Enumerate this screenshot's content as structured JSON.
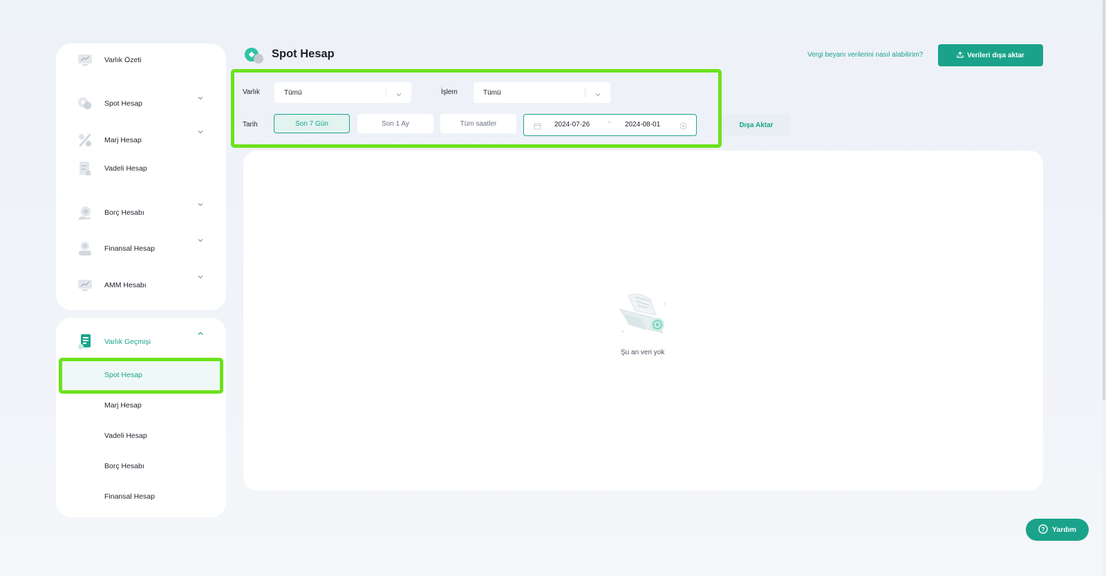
{
  "sidebar": {
    "accounts": [
      {
        "label": "Varlık Özeti",
        "icon": "chart-monitor-icon",
        "has_chevron": false
      },
      {
        "label": "Spot Hesap",
        "icon": "coins-icon",
        "has_chevron": true
      },
      {
        "label": "Marj Hesap",
        "icon": "percent-icon",
        "has_chevron": true
      },
      {
        "label": "Vadeli Hesap",
        "icon": "document-icon",
        "has_chevron": false
      },
      {
        "label": "Borç Hesabı",
        "icon": "loan-coin-icon",
        "has_chevron": true
      },
      {
        "label": "Finansal Hesap",
        "icon": "finance-person-icon",
        "has_chevron": true
      },
      {
        "label": "AMM Hesabı",
        "icon": "amm-monitor-icon",
        "has_chevron": true
      }
    ],
    "history": {
      "label": "Varlık Geçmişi",
      "icon": "history-document-icon",
      "items": [
        "Spot Hesap",
        "Marj Hesap",
        "Vadeli Hesap",
        "Borç Hesabı",
        "Finansal Hesap"
      ],
      "selected": "Spot Hesap"
    }
  },
  "header": {
    "title": "Spot Hesap",
    "help_link": "Vergi beyanı verilerini nasıl alabilirim?",
    "export_all_label": "Verileri dışa aktar"
  },
  "filters": {
    "asset_label": "Varlık",
    "asset_value": "Tümü",
    "operation_label": "İşlem",
    "operation_value": "Tümü",
    "date_label": "Tarih",
    "ranges": [
      "Son 7 Gün",
      "Son 1 Ay",
      "Tüm saatler"
    ],
    "active_range": "Son 7 Gün",
    "start_date": "2024-07-26",
    "separator": "~",
    "end_date": "2024-08-01",
    "export_label": "Dışa Aktar"
  },
  "content": {
    "empty_text": "Şu an veri yok"
  },
  "help_button": {
    "label": "Yardım"
  },
  "colors": {
    "accent": "#1aa38a",
    "highlight": "#6ce21b",
    "background": "#edf1f8"
  }
}
